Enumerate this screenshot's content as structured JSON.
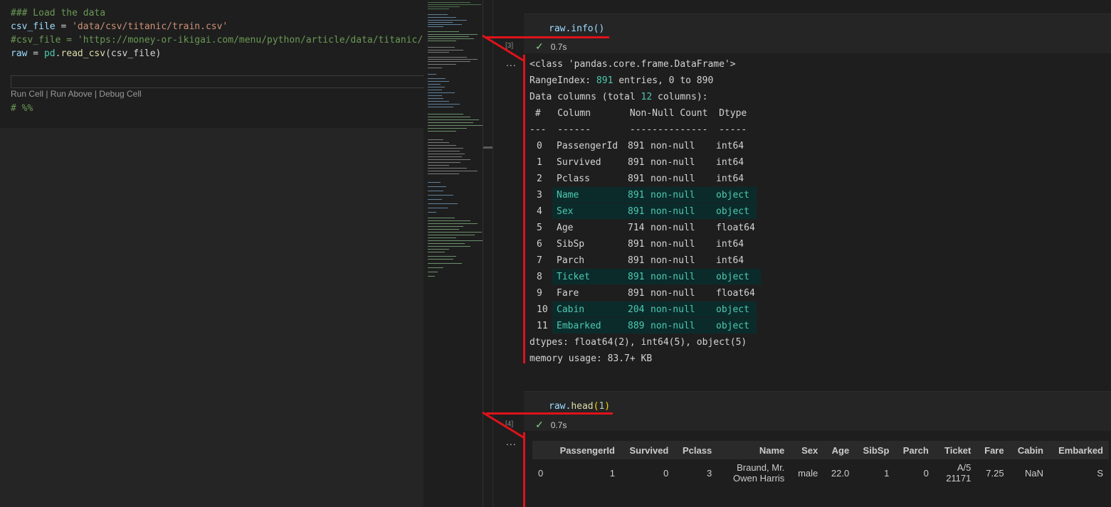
{
  "editor": {
    "comment_load": "### Load the data",
    "line2": {
      "var": "csv_file",
      "op": " = ",
      "val": "'data/csv/titanic/train.csv'"
    },
    "line3": "#csv_file = 'https://money-or-ikigai.com/menu/python/article/data/titanic/t",
    "line4": {
      "var": "raw",
      "op": " = ",
      "mod": "pd",
      "dot": ".",
      "fn": "read_csv",
      "args": "(csv_file)"
    },
    "codelens": "Run Cell | Run Above | Debug Cell",
    "cell_marker": "# %%"
  },
  "cells": [
    {
      "code": "raw.info()",
      "count": "[3]",
      "status": "0.7s",
      "more": "...",
      "output": {
        "class_line": "<class 'pandas.core.frame.DataFrame'>",
        "range_prefix": "RangeIndex: ",
        "range_n": "891",
        "range_suffix": " entries, 0 to 890",
        "cols_prefix": "Data columns (total ",
        "cols_n": "12",
        "cols_suffix": " columns):",
        "header": " #   Column       Non-Null Count  Dtype  ",
        "sep": "---  ------       --------------  -----  ",
        "rows": [
          {
            "i": "0",
            "name": "PassengerId",
            "count": "891",
            "nn": "non-null",
            "dtype": "int64",
            "hl": false
          },
          {
            "i": "1",
            "name": "Survived",
            "count": "891",
            "nn": "non-null",
            "dtype": "int64",
            "hl": false
          },
          {
            "i": "2",
            "name": "Pclass",
            "count": "891",
            "nn": "non-null",
            "dtype": "int64",
            "hl": false
          },
          {
            "i": "3",
            "name": "Name",
            "count": "891",
            "nn": "non-null",
            "dtype": "object",
            "hl": true
          },
          {
            "i": "4",
            "name": "Sex",
            "count": "891",
            "nn": "non-null",
            "dtype": "object",
            "hl": true
          },
          {
            "i": "5",
            "name": "Age",
            "count": "714",
            "nn": "non-null",
            "dtype": "float64",
            "hl": false
          },
          {
            "i": "6",
            "name": "SibSp",
            "count": "891",
            "nn": "non-null",
            "dtype": "int64",
            "hl": false
          },
          {
            "i": "7",
            "name": "Parch",
            "count": "891",
            "nn": "non-null",
            "dtype": "int64",
            "hl": false
          },
          {
            "i": "8",
            "name": "Ticket",
            "count": "891",
            "nn": "non-null",
            "dtype": "object",
            "hl": true
          },
          {
            "i": "9",
            "name": "Fare",
            "count": "891",
            "nn": "non-null",
            "dtype": "float64",
            "hl": false
          },
          {
            "i": "10",
            "name": "Cabin",
            "count": "204",
            "nn": "non-null",
            "dtype": "object",
            "hl": true
          },
          {
            "i": "11",
            "name": "Embarked",
            "count": "889",
            "nn": "non-null",
            "dtype": "object",
            "hl": true
          }
        ],
        "dtypes": "dtypes: float64(2), int64(5), object(5)",
        "memory": "memory usage: 83.7+ KB"
      }
    },
    {
      "code_obj": "raw.",
      "code_fn": "head",
      "code_open": "(",
      "code_arg": "1",
      "code_close": ")",
      "count": "[4]",
      "status": "0.7s",
      "more": "...",
      "table": {
        "headers": [
          "",
          "PassengerId",
          "Survived",
          "Pclass",
          "Name",
          "Sex",
          "Age",
          "SibSp",
          "Parch",
          "Ticket",
          "Fare",
          "Cabin",
          "Embarked"
        ],
        "row": [
          "0",
          "1",
          "0",
          "3",
          "Braund, Mr. Owen Harris",
          "male",
          "22.0",
          "1",
          "0",
          "A/5 21171",
          "7.25",
          "NaN",
          "S"
        ]
      }
    }
  ],
  "colors": {
    "annotation": "#e0121a",
    "highlight": "#0b2b2b",
    "teal": "#4ec9b0",
    "check": "#89d185"
  }
}
